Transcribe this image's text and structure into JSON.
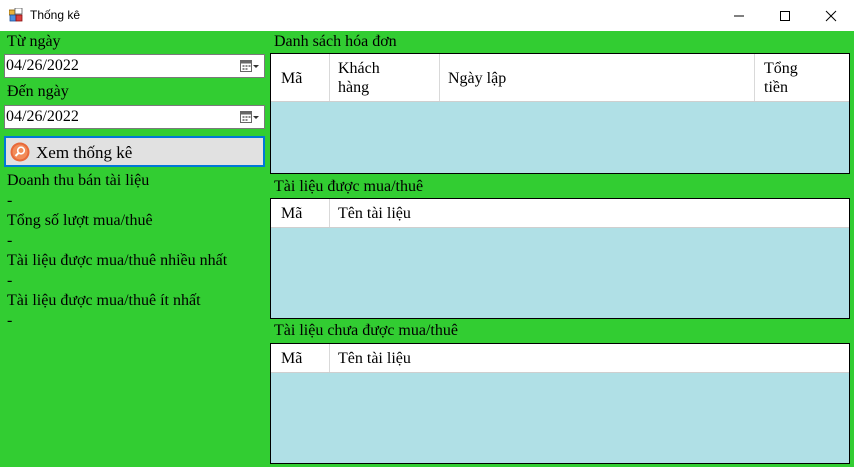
{
  "window": {
    "title": "Thống kê"
  },
  "filter": {
    "from_label": "Từ ngày",
    "from_value": "04/26/2022",
    "to_label": "Đến ngày",
    "to_value": "04/26/2022",
    "view_button": "Xem thống kê"
  },
  "stats": [
    {
      "label": "Doanh thu bán tài liệu",
      "value": "-"
    },
    {
      "label": "Tổng số lượt mua/thuê",
      "value": "-"
    },
    {
      "label": "Tài liệu được mua/thuê nhiều nhất",
      "value": "-"
    },
    {
      "label": "Tài liệu được mua/thuê ít nhất",
      "value": "-"
    }
  ],
  "invoices": {
    "title": "Danh sách hóa đơn",
    "columns": [
      "Mã",
      "Khách hàng",
      "Ngày lập",
      "Tổng tiền"
    ]
  },
  "purchased": {
    "title": "Tài liệu được mua/thuê",
    "columns": [
      "Mã",
      "Tên tài liệu"
    ]
  },
  "not_purchased": {
    "title": "Tài liệu chưa được mua/thuê",
    "columns": [
      "Mã",
      "Tên tài liệu"
    ]
  },
  "icons": [
    "app-icon",
    "minimize-icon",
    "maximize-icon",
    "close-icon",
    "calendar-icon",
    "search-icon"
  ]
}
